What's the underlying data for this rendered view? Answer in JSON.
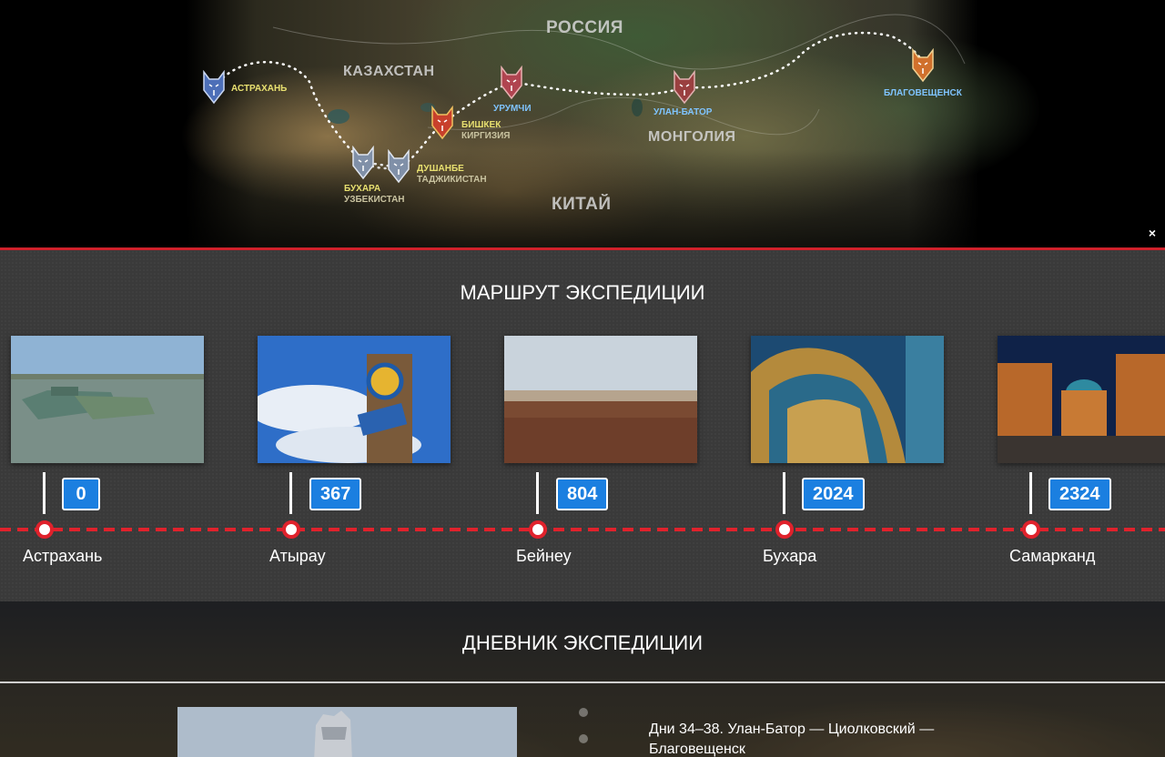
{
  "map": {
    "countries": [
      "РОССИЯ",
      "КАЗАХСТАН",
      "МОНГОЛИЯ",
      "КИТАЙ"
    ],
    "cities": [
      {
        "name": "АСТРАХАНЬ",
        "country": "",
        "name_color": "#e8e070"
      },
      {
        "name": "БИШКЕК",
        "country": "КИРГИЗИЯ",
        "name_color": "#e8e070"
      },
      {
        "name": "БУХАРА",
        "country": "УЗБЕКИСТАН",
        "name_color": "#e8e070"
      },
      {
        "name": "ДУШАНБЕ",
        "country": "ТАДЖИКИСТАН",
        "name_color": "#e8e070"
      },
      {
        "name": "УРУМЧИ",
        "country": "",
        "name_color": "#7fc4ff"
      },
      {
        "name": "УЛАН-БАТОР",
        "country": "",
        "name_color": "#7fc4ff"
      },
      {
        "name": "БЛАГОВЕЩЕНСК",
        "country": "",
        "name_color": "#7fc4ff"
      }
    ],
    "close_label": "×"
  },
  "route": {
    "title": "МАРШРУТ ЭКСПЕДИЦИИ",
    "stops": [
      {
        "name": "Астрахань",
        "km": "0"
      },
      {
        "name": "Атырау",
        "km": "367"
      },
      {
        "name": "Бейнеу",
        "km": "804"
      },
      {
        "name": "Бухара",
        "km": "2024"
      },
      {
        "name": "Самарканд",
        "km": "2324"
      }
    ],
    "km_badge_color": "#1b7fe0",
    "track_color": "#e0222c"
  },
  "diary": {
    "title": "ДНЕВНИК ЭКСПЕДИЦИИ",
    "entry_title": "Дни 34–38. Улан-Батор — Циолковский — Благовещенск"
  }
}
